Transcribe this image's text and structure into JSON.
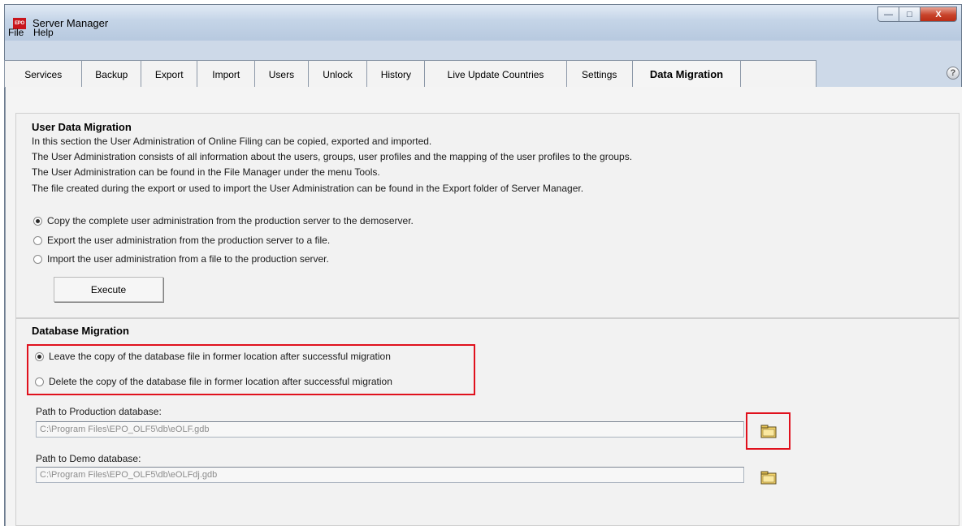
{
  "window": {
    "app_icon_text": "EPO",
    "title": "Server Manager",
    "controls": {
      "minimize": "—",
      "maximize": "□",
      "close": "X"
    }
  },
  "menu": {
    "items": [
      "File",
      "Help"
    ]
  },
  "tabs": [
    {
      "label": "Services"
    },
    {
      "label": "Backup"
    },
    {
      "label": "Export"
    },
    {
      "label": "Import"
    },
    {
      "label": "Users"
    },
    {
      "label": "Unlock"
    },
    {
      "label": "History"
    },
    {
      "label": "Live Update Countries"
    },
    {
      "label": "Settings"
    },
    {
      "label": "Data Migration",
      "active": true
    }
  ],
  "help_icon": "?",
  "user_data_migration": {
    "heading": "User Data Migration",
    "description": [
      "In this section the User Administration of Online Filing can be copied, exported and imported.",
      "The User Administration consists of all information about the users, groups, user profiles and the mapping of the user profiles to the groups.",
      "The User Administration can be found in the File Manager under the menu Tools.",
      "The file created during the export or used to import the User Administration can be found in the Export folder of Server Manager."
    ],
    "options": [
      {
        "label": "Copy the complete user administration from the production server to the demoserver.",
        "checked": true
      },
      {
        "label": "Export the user administration from the production server to a file.",
        "checked": false
      },
      {
        "label": "Import the user administration from a file to the production server.",
        "checked": false
      }
    ],
    "execute_label": "Execute"
  },
  "database_migration": {
    "heading": "Database Migration",
    "options": [
      {
        "label": "Leave the copy of the database file in former location after successful migration",
        "checked": true
      },
      {
        "label": "Delete the copy of the database file in former location after successful migration",
        "checked": false
      }
    ],
    "production_label": "Path to Production database:",
    "production_path": "C:\\Program Files\\EPO_OLF5\\db\\eOLF.gdb",
    "demo_label": "Path to Demo database:",
    "demo_path": "C:\\Program Files\\EPO_OLF5\\db\\eOLFdj.gdb"
  },
  "colors": {
    "highlight": "#e0111d",
    "titlebar": "#c4d4e7",
    "close_button": "#c8432a"
  }
}
